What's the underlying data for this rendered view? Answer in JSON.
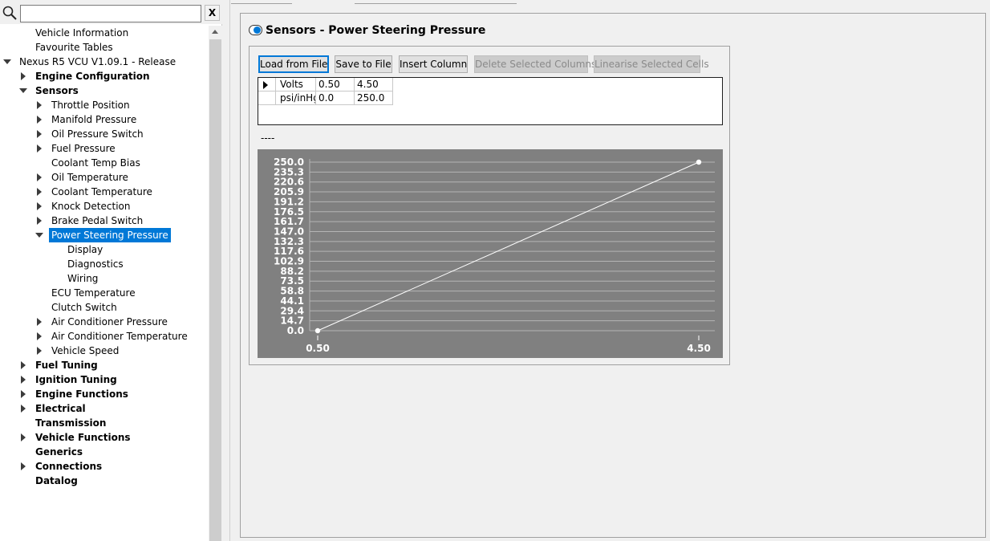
{
  "search": {
    "value": "",
    "placeholder": "",
    "clear_label": "X"
  },
  "tree": [
    {
      "label": "Vehicle Information",
      "level": 1,
      "expander": "none",
      "bold": false
    },
    {
      "label": "Favourite Tables",
      "level": 1,
      "expander": "none",
      "bold": false
    },
    {
      "label": "Nexus R5 VCU V1.09.1 - Release",
      "level": 0,
      "expander": "down",
      "bold": false
    },
    {
      "label": "Engine Configuration",
      "level": 1,
      "expander": "right",
      "bold": true
    },
    {
      "label": "Sensors",
      "level": 1,
      "expander": "down",
      "bold": true
    },
    {
      "label": "Throttle Position",
      "level": 2,
      "expander": "right",
      "bold": false
    },
    {
      "label": "Manifold Pressure",
      "level": 2,
      "expander": "right",
      "bold": false
    },
    {
      "label": "Oil Pressure Switch",
      "level": 2,
      "expander": "right",
      "bold": false
    },
    {
      "label": "Fuel Pressure",
      "level": 2,
      "expander": "right",
      "bold": false
    },
    {
      "label": "Coolant Temp Bias",
      "level": 2,
      "expander": "none",
      "bold": false
    },
    {
      "label": "Oil Temperature",
      "level": 2,
      "expander": "right",
      "bold": false
    },
    {
      "label": "Coolant Temperature",
      "level": 2,
      "expander": "right",
      "bold": false
    },
    {
      "label": "Knock Detection",
      "level": 2,
      "expander": "right",
      "bold": false
    },
    {
      "label": "Brake Pedal Switch",
      "level": 2,
      "expander": "right",
      "bold": false
    },
    {
      "label": "Power Steering Pressure",
      "level": 2,
      "expander": "down",
      "bold": false,
      "selected": true
    },
    {
      "label": "Display",
      "level": 3,
      "expander": "none",
      "bold": false
    },
    {
      "label": "Diagnostics",
      "level": 3,
      "expander": "none",
      "bold": false
    },
    {
      "label": "Wiring",
      "level": 3,
      "expander": "none",
      "bold": false
    },
    {
      "label": "ECU Temperature",
      "level": 2,
      "expander": "none",
      "bold": false
    },
    {
      "label": "Clutch Switch",
      "level": 2,
      "expander": "none",
      "bold": false
    },
    {
      "label": "Air Conditioner Pressure",
      "level": 2,
      "expander": "right",
      "bold": false
    },
    {
      "label": "Air Conditioner Temperature",
      "level": 2,
      "expander": "right",
      "bold": false
    },
    {
      "label": "Vehicle Speed",
      "level": 2,
      "expander": "right",
      "bold": false
    },
    {
      "label": "Fuel Tuning",
      "level": 1,
      "expander": "right",
      "bold": true
    },
    {
      "label": "Ignition Tuning",
      "level": 1,
      "expander": "right",
      "bold": true
    },
    {
      "label": "Engine Functions",
      "level": 1,
      "expander": "right",
      "bold": true
    },
    {
      "label": "Electrical",
      "level": 1,
      "expander": "right",
      "bold": true
    },
    {
      "label": "Transmission",
      "level": 1,
      "expander": "none",
      "bold": true
    },
    {
      "label": "Vehicle Functions",
      "level": 1,
      "expander": "right",
      "bold": true
    },
    {
      "label": "Generics",
      "level": 1,
      "expander": "none",
      "bold": true
    },
    {
      "label": "Connections",
      "level": 1,
      "expander": "right",
      "bold": true
    },
    {
      "label": "Datalog",
      "level": 1,
      "expander": "none",
      "bold": true
    }
  ],
  "panel": {
    "title": "Sensors - Power Steering Pressure",
    "status_text": "----"
  },
  "toolbar": {
    "load_label": "Load from File",
    "save_label": "Save to File",
    "insert_label": "Insert Column",
    "delete_label": "Delete Selected Columns",
    "linearise_label": "Linearise Selected Cells"
  },
  "grid": {
    "rows": [
      {
        "header": "Volts",
        "cells": [
          "0.50",
          "4.50"
        ]
      },
      {
        "header": "psi/inHg",
        "cells": [
          "0.0",
          "250.0"
        ]
      }
    ]
  },
  "colors": {
    "selection": "#0078d7",
    "chart_bg": "#808080",
    "chart_line": "#ffffff"
  },
  "chart_data": {
    "type": "line",
    "x": [
      0.5,
      4.5
    ],
    "values": [
      0.0,
      250.0
    ],
    "x_ticks": [
      "0.50",
      "4.50"
    ],
    "y_ticks": [
      "250.0",
      "235.3",
      "220.6",
      "205.9",
      "191.2",
      "176.5",
      "161.7",
      "147.0",
      "132.3",
      "117.6",
      "102.9",
      "88.2",
      "73.5",
      "58.8",
      "44.1",
      "29.4",
      "14.7",
      "0.0"
    ],
    "xlim": [
      0.5,
      4.5
    ],
    "ylim": [
      0,
      250
    ],
    "grid": true
  }
}
